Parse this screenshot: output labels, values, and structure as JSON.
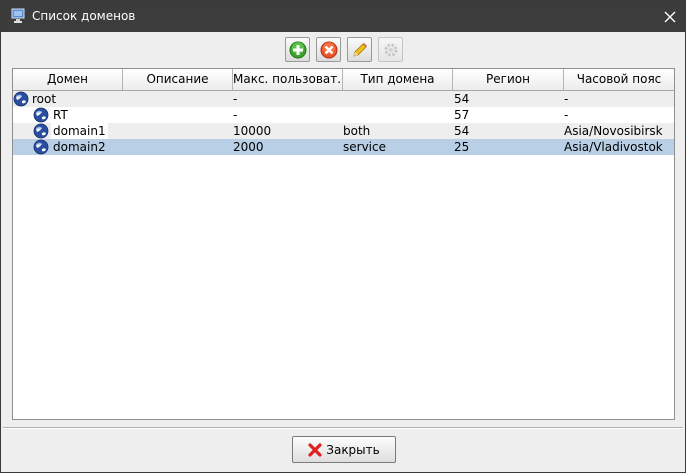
{
  "window": {
    "title": "Список доменов"
  },
  "toolbar": {
    "buttons": [
      {
        "name": "add",
        "icon": "plus-circle-icon",
        "enabled": true
      },
      {
        "name": "delete",
        "icon": "x-circle-icon",
        "enabled": true
      },
      {
        "name": "edit",
        "icon": "pencil-icon",
        "enabled": true
      },
      {
        "name": "settings",
        "icon": "gear-icon",
        "enabled": false
      }
    ]
  },
  "table": {
    "columns": [
      "Домен",
      "Описание",
      "Макс. пользоват...",
      "Тип домена",
      "Регион",
      "Часовой пояс"
    ],
    "rows": [
      {
        "domain": "root",
        "description": "",
        "max_users": "-",
        "type": "",
        "region": "54",
        "timezone": "-"
      },
      {
        "domain": "RT",
        "description": "",
        "max_users": "-",
        "type": "",
        "region": "57",
        "timezone": "-"
      },
      {
        "domain": "domain1",
        "description": "",
        "max_users": "10000",
        "type": "both",
        "region": "54",
        "timezone": "Asia/Novosibirsk"
      },
      {
        "domain": "domain2",
        "description": "",
        "max_users": "2000",
        "type": "service",
        "region": "25",
        "timezone": "Asia/Vladivostok"
      }
    ]
  },
  "footer": {
    "close_label": "Закрыть"
  },
  "colors": {
    "titlebar": "#3c3c3c",
    "selected_row": "#b8cfe5",
    "add_green": "#3aa52a",
    "delete_red": "#e8562a"
  }
}
